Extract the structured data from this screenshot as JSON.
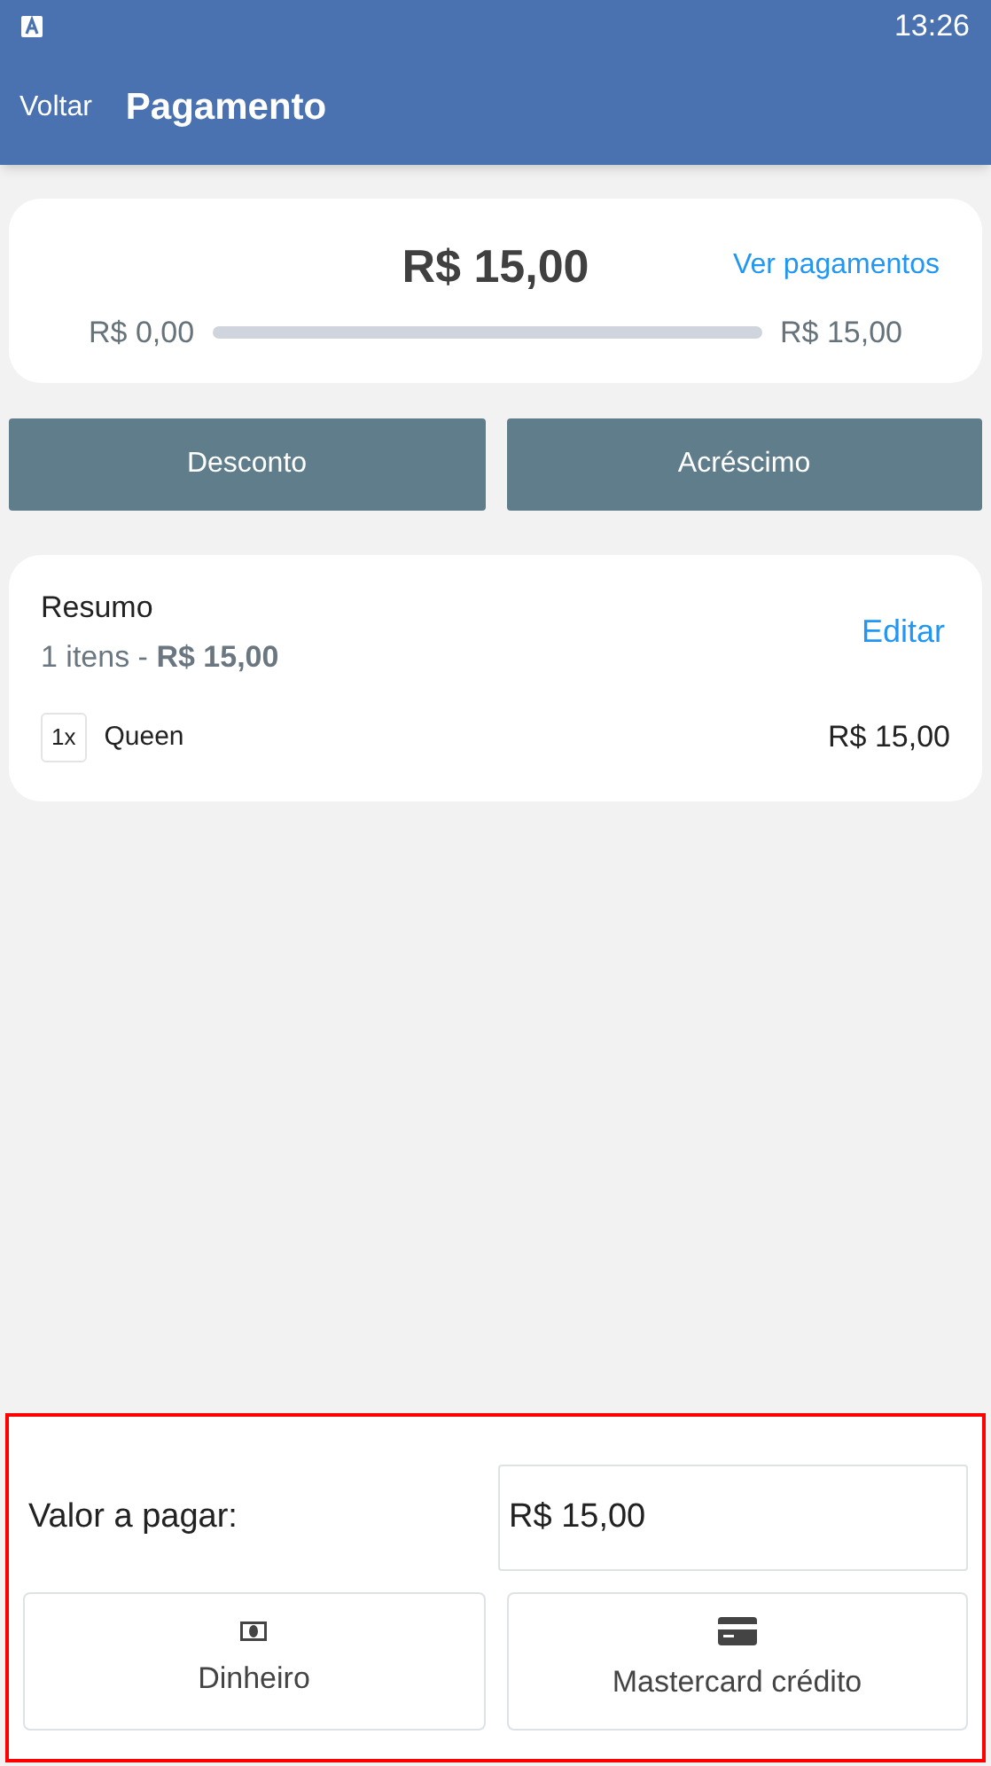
{
  "status_bar": {
    "time": "13:26"
  },
  "app_bar": {
    "back": "Voltar",
    "title": "Pagamento"
  },
  "total_card": {
    "amount": "R$ 15,00",
    "link": "Ver pagamentos",
    "progress": {
      "min": "R$ 0,00",
      "max": "R$ 15,00",
      "level": 0
    }
  },
  "actions": [
    "Desconto",
    "Acréscimo"
  ],
  "summary": {
    "title": "Resumo",
    "subtitle_prefix": "1 itens - ",
    "subtitle_total": "R$ 15,00",
    "edit": "Editar",
    "items": [
      {
        "qty": "1x",
        "name": "Queen",
        "price": "R$ 15,00"
      }
    ]
  },
  "payment": {
    "highlighted": true,
    "label": "Valor a pagar:",
    "value": "R$ 15,00",
    "methods": [
      {
        "kind": "cash",
        "label": "Dinheiro"
      },
      {
        "kind": "card",
        "label": "Mastercard crédito"
      }
    ]
  }
}
